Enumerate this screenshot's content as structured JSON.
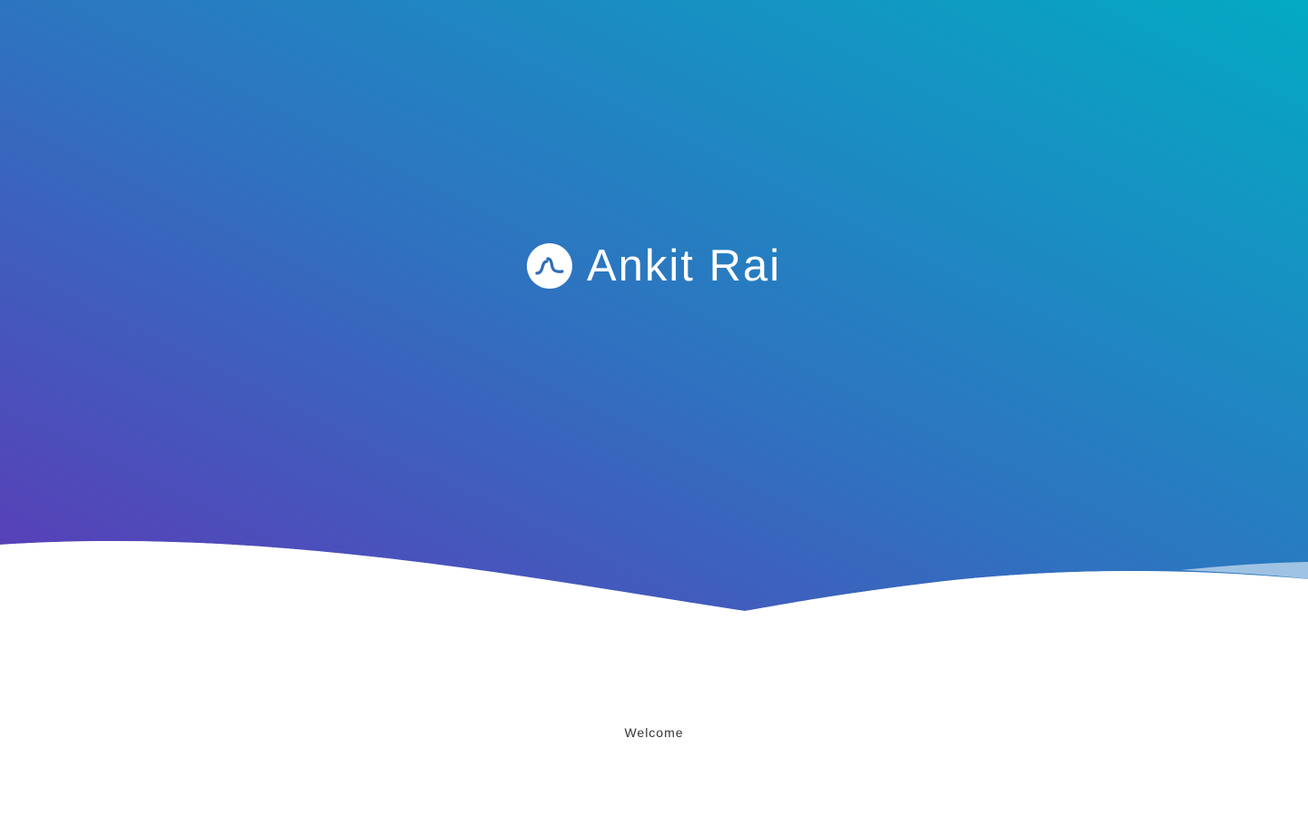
{
  "brand": {
    "name": "Ankit Rai",
    "logo_icon": "stylized-wave-logo-icon"
  },
  "welcome": {
    "text": "Welcome"
  },
  "colors": {
    "gradient_start": "#5a3db8",
    "gradient_mid": "#2f72c0",
    "gradient_end": "#03aac3",
    "wave_light": "#e6e4f4",
    "text": "#333333",
    "background": "#ffffff"
  }
}
